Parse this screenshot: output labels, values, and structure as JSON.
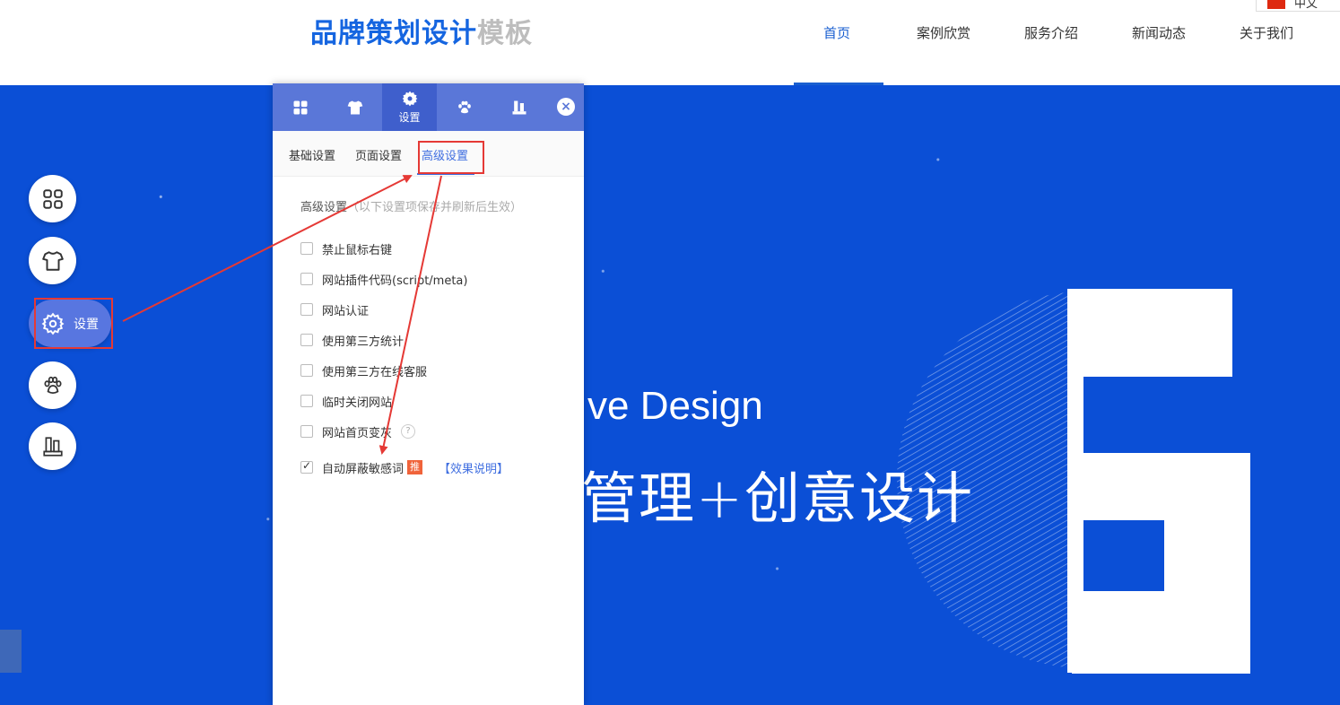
{
  "header": {
    "logo_primary": "品牌策划设计",
    "logo_secondary": "模板",
    "nav": [
      {
        "label": "首页",
        "active": true
      },
      {
        "label": "案例欣赏",
        "active": false
      },
      {
        "label": "服务介绍",
        "active": false
      },
      {
        "label": "新闻动态",
        "active": false
      },
      {
        "label": "关于我们",
        "active": false
      }
    ],
    "language": "中文"
  },
  "hero": {
    "en_text": "ve Design",
    "cn_text": "管理+创意设计",
    "big_letter": "G"
  },
  "float_toolbar": {
    "items": [
      {
        "icon": "apps-grid-icon"
      },
      {
        "icon": "tshirt-icon"
      },
      {
        "icon": "gear-icon",
        "label": "设置",
        "active": true
      },
      {
        "icon": "paw-icon"
      },
      {
        "icon": "building-icon"
      }
    ]
  },
  "panel": {
    "tabs": [
      {
        "icon": "apps-grid-icon"
      },
      {
        "icon": "tshirt-icon"
      },
      {
        "icon": "gear-icon",
        "label": "设置",
        "active": true
      },
      {
        "icon": "paw-icon"
      },
      {
        "icon": "building-icon"
      }
    ],
    "close_label": "×",
    "subtabs": [
      "基础设置",
      "页面设置",
      "高级设置"
    ],
    "active_subtab": "高级设置",
    "section_title": "高级设置",
    "section_note": "（以下设置项保存并刷新后生效）",
    "options": [
      {
        "label": "禁止鼠标右键",
        "checked": false
      },
      {
        "label": "网站插件代码(script/meta)",
        "checked": false
      },
      {
        "label": "网站认证",
        "checked": false
      },
      {
        "label": "使用第三方统计",
        "checked": false
      },
      {
        "label": "使用第三方在线客服",
        "checked": false
      },
      {
        "label": "临时关闭网站",
        "checked": false
      },
      {
        "label": "网站首页变灰",
        "checked": false
      },
      {
        "label": "自动屏蔽敏感词",
        "checked": true
      }
    ],
    "help_mark": "?",
    "recommend_badge": "推",
    "effect_link": "【效果说明】"
  },
  "colors": {
    "hero_bg": "#0b4fd6",
    "panel_tab_bg": "#5a77d8",
    "accent_blue": "#3f6ee0",
    "highlight_red": "#e53935"
  }
}
